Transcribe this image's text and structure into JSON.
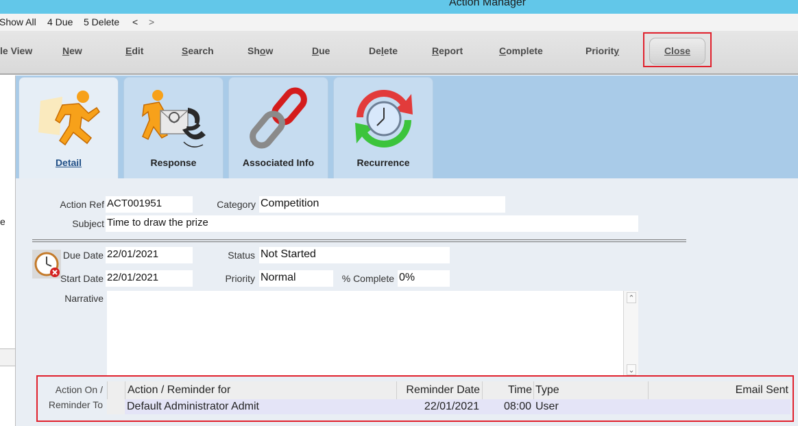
{
  "window": {
    "title": "Action Manager"
  },
  "quickbar": {
    "show_all": "Show All",
    "due": "4 Due",
    "delete": "5 Delete",
    "prev": "<",
    "next": ">"
  },
  "toolbar": {
    "view": {
      "prefix": "le ",
      "u": "V",
      "rest": "iew"
    },
    "new": {
      "u": "N",
      "rest": "ew"
    },
    "edit": {
      "u": "E",
      "rest": "dit"
    },
    "search": {
      "u": "S",
      "rest": "earch"
    },
    "show": {
      "pre": "Sh",
      "u": "o",
      "rest": "w"
    },
    "due": {
      "u": "D",
      "rest": "ue"
    },
    "delete": {
      "pre": "De",
      "u": "l",
      "rest": "ete"
    },
    "report": {
      "u": "R",
      "rest": "eport"
    },
    "complete": {
      "u": "C",
      "rest": "omplete"
    },
    "priority": {
      "pre": "Priorit",
      "u": "y",
      "rest": ""
    },
    "close": "Close"
  },
  "left_panel": {
    "fragment": "e"
  },
  "tabs": [
    {
      "label": "Detail",
      "icon": "running-man-icon"
    },
    {
      "label": "Response",
      "icon": "response-phone-icon"
    },
    {
      "label": "Associated Info",
      "icon": "chain-link-icon"
    },
    {
      "label": "Recurrence",
      "icon": "recurrence-clock-icon"
    }
  ],
  "form": {
    "action_ref": {
      "label": "Action Ref",
      "value": "ACT001951"
    },
    "category": {
      "label": "Category",
      "value": "Competition"
    },
    "subject": {
      "label": "Subject",
      "value": "Time to draw the prize"
    },
    "due_date": {
      "label": "Due Date",
      "value": "22/01/2021"
    },
    "start_date": {
      "label": "Start Date",
      "value": "22/01/2021"
    },
    "status": {
      "label": "Status",
      "value": "Not Started"
    },
    "priority": {
      "label": "Priority",
      "value": "Normal"
    },
    "percent_complete": {
      "label": "% Complete",
      "value": "0%"
    },
    "narrative": {
      "label": "Narrative",
      "value": ""
    }
  },
  "reminders": {
    "label_line1": "Action On /",
    "label_line2": "Reminder To",
    "columns": [
      "Action / Reminder for",
      "Reminder Date",
      "Time",
      "Type",
      "Email Sent"
    ],
    "rows": [
      {
        "for": "Default Administrator Admit",
        "date": "22/01/2021",
        "time": "08:00",
        "type": "User",
        "email_sent": ""
      }
    ]
  },
  "colors": {
    "titlebar": "#62c7e9",
    "tabstrip": "#a9cbe8",
    "highlight": "#e0202c",
    "content": "#e9eef4"
  }
}
